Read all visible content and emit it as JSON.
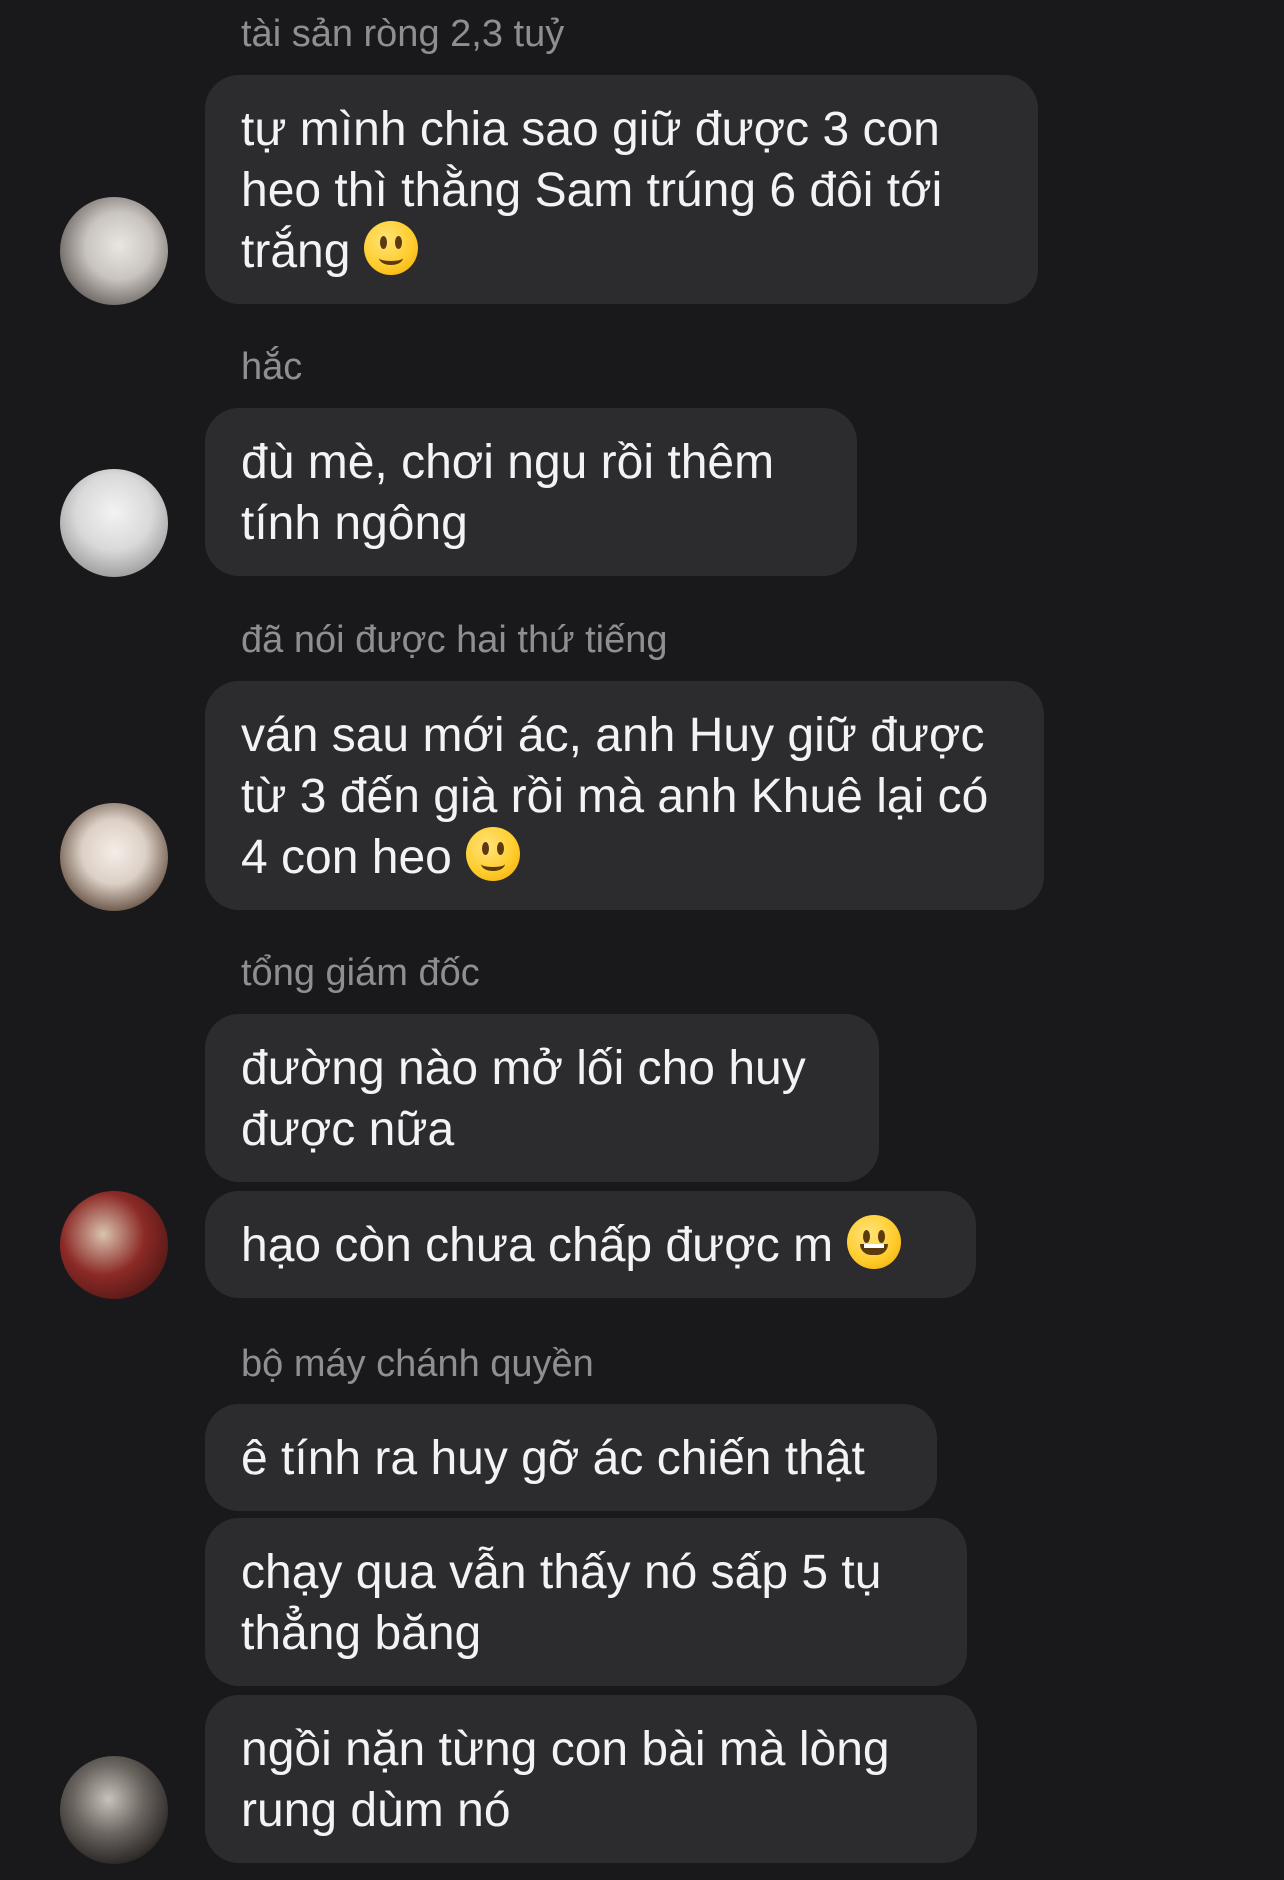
{
  "messages": [
    {
      "sender": "tài sản ròng 2,3 tuỷ",
      "bubbles": [
        {
          "text": "tự mình chia sao giữ được 3 con heo thì thằng Sam trúng 6 đôi tới trắng",
          "emoji": "slightly-smiling-face"
        }
      ]
    },
    {
      "sender": "hắc",
      "bubbles": [
        {
          "text": "đù mè, chơi ngu rồi thêm tính ngông"
        }
      ]
    },
    {
      "sender": "đã nói được hai thứ tiếng",
      "bubbles": [
        {
          "text": "ván sau mới ác, anh Huy giữ được từ 3 đến già rồi mà anh Khuê lại có 4 con heo",
          "emoji": "slightly-smiling-face"
        }
      ]
    },
    {
      "sender": "tổng giám đốc",
      "bubbles": [
        {
          "text": "đường nào mở lối cho huy được nữa"
        },
        {
          "text": "hạo còn chưa chấp được m",
          "emoji": "grinning-face"
        }
      ]
    },
    {
      "sender": "bộ máy chánh quyền",
      "bubbles": [
        {
          "text": "ê tính ra huy gỡ ác chiến thật"
        },
        {
          "text": "chạy qua vẫn thấy nó sấp 5 tụ thẳng băng"
        },
        {
          "text": "ngồi nặn từng con bài mà lòng rung dùm nó"
        }
      ]
    }
  ],
  "colors": {
    "background": "#19191b",
    "bubble": "#2c2c2e",
    "sender_text": "#8e8e93",
    "message_text": "#f2f2f7"
  }
}
